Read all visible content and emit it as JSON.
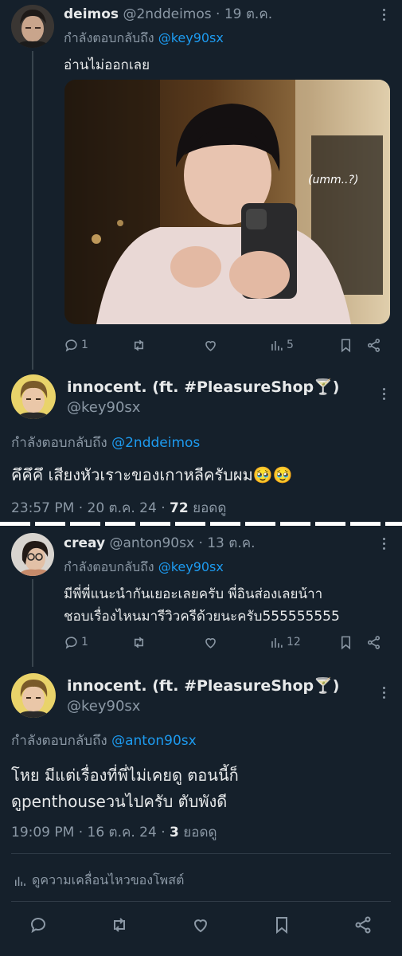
{
  "tweet1": {
    "display_name": "deimos",
    "handle": "@2nddeimos",
    "date": "· 19 ต.ค.",
    "replying_prefix": "กำลังตอบกลับถึง",
    "replying_to": "@key90sx",
    "text": "อ่านไม่ออกเลย",
    "image_caption": "(umm..?)",
    "replies": "1",
    "views": "5"
  },
  "tweet2": {
    "display_name": "innocent. (ft. #PleasureShop🍸)",
    "handle": "@key90sx",
    "replying_prefix": "กำลังตอบกลับถึง",
    "replying_to": "@2nddeimos",
    "text": "คึคึคึ เสียงหัวเราะของเกาหลีครับผม🥹🥹",
    "time": "23:57 PM · 20 ต.ค. 24 · ",
    "views_count": "72",
    "views_label": " ยอดดู"
  },
  "tweet3": {
    "display_name": "creay",
    "handle": "@anton90sx",
    "date": "· 13 ต.ค.",
    "replying_prefix": "กำลังตอบกลับถึง",
    "replying_to": "@key90sx",
    "text_line1": "มีพี่พี่แนะนำกันเยอะเลยครับ พี่อินส่องเลยน้าา",
    "text_line2": "ชอบเรื่องไหนมารีวิวครีด้วยนะครับ555555555",
    "replies": "1",
    "views": "12"
  },
  "tweet4": {
    "display_name": "innocent. (ft. #PleasureShop🍸)",
    "handle": "@key90sx",
    "replying_prefix": "กำลังตอบกลับถึง",
    "replying_to": "@anton90sx",
    "text_line1": "โหย มีแต่เรื่องที่พี่ไม่เคยดู ตอนนี้ก็",
    "text_line2": "ดูpenthouseวนไปครับ ตับพังดี",
    "time": "19:09 PM · 16 ต.ค. 24 · ",
    "views_count": "3",
    "views_label": " ยอดดู"
  },
  "engagement_label": "ดูความเคลื่อนไหวของโพสต์",
  "colors": {
    "background": "#15202b",
    "accent": "#1d9bf0",
    "muted": "#8b98a5"
  }
}
